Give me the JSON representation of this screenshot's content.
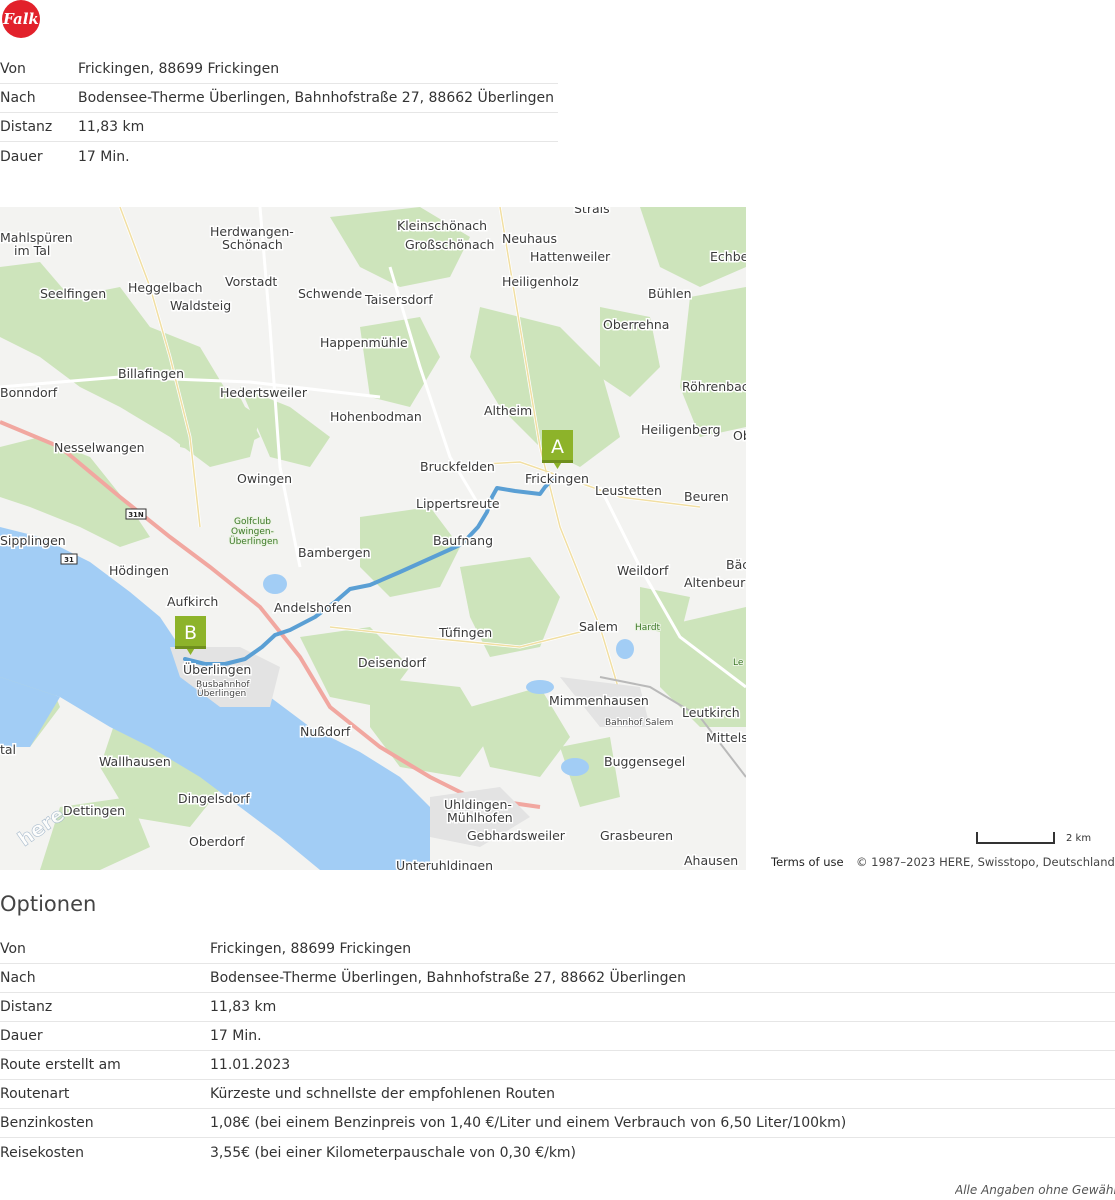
{
  "logo": {
    "text": "Falk",
    "color": "#e2212b"
  },
  "summary": {
    "rows": [
      {
        "label": "Von",
        "value": "Frickingen, 88699 Frickingen"
      },
      {
        "label": "Nach",
        "value": "Bodensee-Therme Überlingen, Bahnhofstraße 27, 88662 Überlingen"
      },
      {
        "label": "Distanz",
        "value": "11,83 km"
      },
      {
        "label": "Dauer",
        "value": "17 Min."
      }
    ]
  },
  "map": {
    "marker_start": "A",
    "marker_end": "B",
    "marker_color": "#8db32a",
    "route_color": "#5a9fd4",
    "water_color": "#9ccbf5",
    "forest_color": "#c9e2b7",
    "labels": {
      "strais": "Strais",
      "kleinschoenach": "Kleinschönach",
      "grossschoenach": "Großschönach",
      "neuhaus": "Neuhaus",
      "hattenweiler": "Hattenweiler",
      "echbeck": "Echbe",
      "herdwangen1": "Herdwangen-",
      "herdwangen2": "Schönach",
      "mahlspueren1": "Mahlspüren",
      "mahlspueren2": "im Tal",
      "heiligenholz": "Heiligenholz",
      "buehlen": "Bühlen",
      "seelfingen": "Seelfingen",
      "heggelbach": "Heggelbach",
      "vorstadt": "Vorstadt",
      "schwende": "Schwende",
      "taisersdorf": "Taisersdorf",
      "waldsteig": "Waldsteig",
      "oberrehna": "Oberrehna",
      "happenmuehle": "Happenmühle",
      "billafingen": "Billafingen",
      "roehrenbach": "Röhrenbac",
      "bonndorf": "Bonndorf",
      "hedertsweiler": "Hedertsweiler",
      "hohenbodman": "Hohenbodman",
      "altheim": "Altheim",
      "heiligenberg": "Heiligenberg",
      "ob": "Ob",
      "nesselwangen": "Nesselwangen",
      "bruckfelden": "Bruckfelden",
      "frickingen": "Frickingen",
      "owingen": "Owingen",
      "leustetten": "Leustetten",
      "beuren": "Beuren",
      "lippertsreute": "Lippertsreute",
      "golfclub1": "Golfclub",
      "golfclub2": "Owingen-",
      "golfclub3": "Überlingen",
      "sipplingen": "Sipplingen",
      "baufnang": "Baufnang",
      "bambergen": "Bambergen",
      "baech": "Bäc",
      "hoedingen": "Hödingen",
      "weildorf": "Weildorf",
      "altenbeuren": "Altenbeur",
      "aufkirch": "Aufkirch",
      "andelshofen": "Andelshofen",
      "tuefingen": "Tüfingen",
      "salem": "Salem",
      "hardt": "Hardt",
      "le": "Le",
      "deisendorf": "Deisendorf",
      "ueberlingen": "Überlingen",
      "busbahnhof1": "Busbahnhof",
      "busbahnhof2": "Überlingen",
      "mimmenhausen": "Mimmenhausen",
      "bahnhof_salem": "Bahnhof Salem",
      "leutkirch": "Leutkirch",
      "mittels": "Mittels",
      "nussdorf": "Nußdorf",
      "tal": "tal",
      "wallhausen": "Wallhausen",
      "buggensegel": "Buggensegel",
      "dingelsdorf": "Dingelsdorf",
      "dettingen": "Dettingen",
      "uhldingen1": "Uhldingen-",
      "uhldingen2": "Mühlhofen",
      "gebhardsweiler": "Gebhardsweiler",
      "grasbeuren": "Grasbeuren",
      "oberdorf": "Oberdorf",
      "ahausen": "Ahausen",
      "unteruhldingen": "Unteruhldingen",
      "road_31n": "31N",
      "road_31": "31",
      "here_logo": "here"
    }
  },
  "scale": {
    "label": "2 km"
  },
  "attribution": {
    "terms": "Terms of use",
    "copyright": "© 1987–2023 HERE, Swisstopo, Deutschland"
  },
  "options": {
    "title": "Optionen",
    "rows": [
      {
        "label": "Von",
        "value": "Frickingen, 88699 Frickingen"
      },
      {
        "label": "Nach",
        "value": "Bodensee-Therme Überlingen, Bahnhofstraße 27, 88662 Überlingen"
      },
      {
        "label": "Distanz",
        "value": "11,83 km"
      },
      {
        "label": "Dauer",
        "value": "17 Min."
      },
      {
        "label": "Route erstellt am",
        "value": "11.01.2023"
      },
      {
        "label": "Routenart",
        "value": "Kürzeste und schnellste der empfohlenen Routen"
      },
      {
        "label": "Benzinkosten",
        "value": "1,08€ (bei einem Benzinpreis von 1,40 €/Liter und einem Verbrauch von 6,50 Liter/100km)"
      },
      {
        "label": "Reisekosten",
        "value": "3,55€ (bei einer Kilometerpauschale von 0,30 €/km)"
      }
    ]
  },
  "disclaimer": "Alle Angaben ohne Gewähr"
}
